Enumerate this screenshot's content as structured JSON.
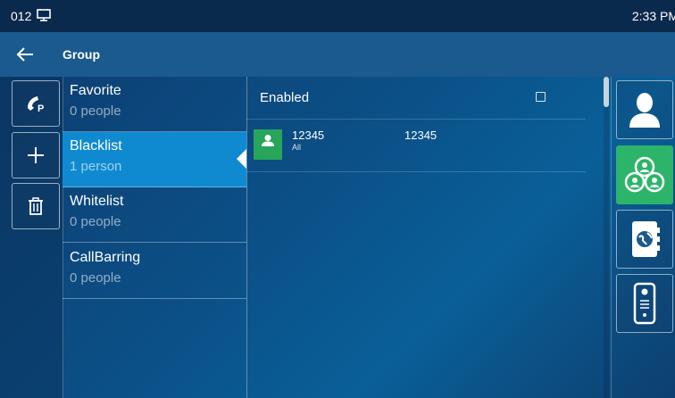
{
  "status": {
    "account": "012",
    "time": "2:33 PM"
  },
  "header": {
    "title": "Group"
  },
  "groups": [
    {
      "name": "Favorite",
      "count": "0 people"
    },
    {
      "name": "Blacklist",
      "count": "1 person"
    },
    {
      "name": "Whitelist",
      "count": "0 people"
    },
    {
      "name": "CallBarring",
      "count": "0 people"
    }
  ],
  "selected_group": "Blacklist",
  "content": {
    "enabled_label": "Enabled",
    "enabled_checked": false,
    "contacts": [
      {
        "name": "12345",
        "group": "All",
        "number": "12345"
      }
    ]
  },
  "left_actions": [
    "phone-p-icon",
    "add-icon",
    "delete-icon"
  ],
  "right_tabs": [
    "contact-icon",
    "group-icon",
    "network-directory-icon",
    "door-phone-icon"
  ],
  "colors": {
    "selected_group_bg": "#0f8ad0",
    "active_tab_bg": "#2cb56a",
    "avatar_bg": "#27a55b",
    "header_bg": "#1a5a8f",
    "status_bg": "#0a2a4d"
  }
}
